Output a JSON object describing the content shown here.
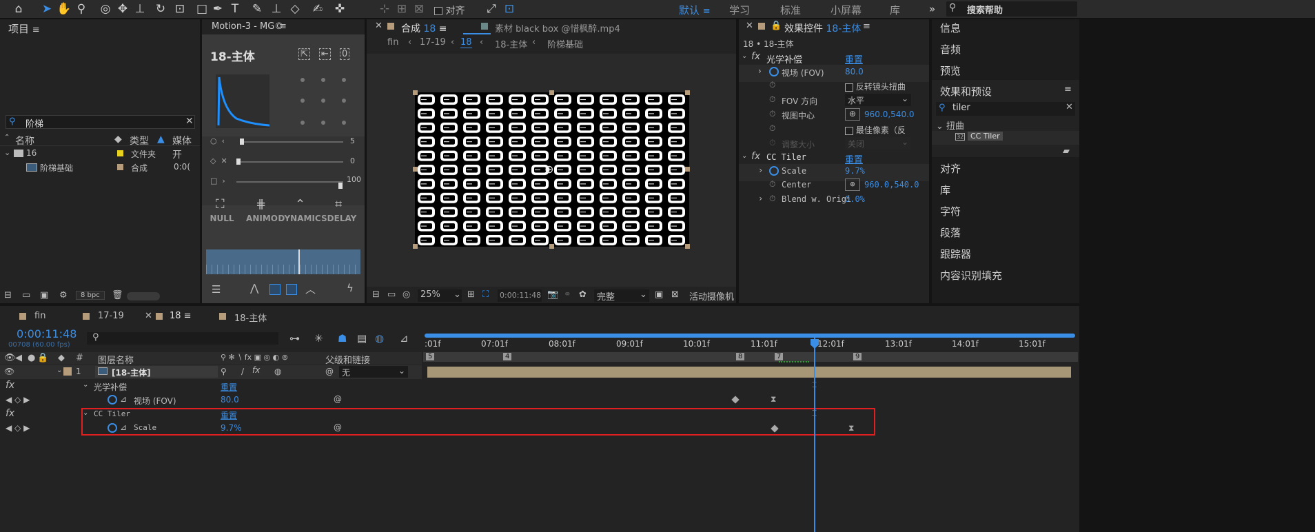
{
  "toolbar": {
    "snap_label": "对齐",
    "workspaces": [
      "默认",
      "学习",
      "标准",
      "小屏幕",
      "库"
    ],
    "more": "»",
    "search_help": "搜索帮助"
  },
  "project": {
    "title": "项目",
    "search_value": "阶梯",
    "columns": {
      "name": "名称",
      "type": "类型",
      "media": "媒体开"
    },
    "items": [
      {
        "name": "16",
        "type": "文件夹",
        "media": ""
      },
      {
        "name": "阶梯基础",
        "type": "合成",
        "media": "0:0("
      }
    ],
    "bpc": "8 bpc"
  },
  "motion": {
    "title": "Motion-3 - MG©",
    "comp": "18-主体",
    "sliders": [
      {
        "value": "5"
      },
      {
        "value": "0"
      },
      {
        "value": "100"
      }
    ],
    "buttons": [
      "NULL",
      "ANIMO",
      "DYNAMICS",
      "DELAY"
    ]
  },
  "comp_viewer": {
    "tab_label": "合成",
    "tab_number": "18",
    "footage_tab": "素材 black box @惜枫醉.mp4",
    "breadcrumbs": [
      "fin",
      "17-19",
      "18",
      "18-主体",
      "阶梯基础"
    ],
    "zoom": "25%",
    "timecode": "0:00:11:48",
    "quality": "完整",
    "camera": "活动摄像机"
  },
  "effects_controls": {
    "title": "效果控件",
    "layer": "18-主体",
    "path": "18 • 18-主体",
    "optics": {
      "name": "光学补偿",
      "reset": "重置",
      "fov_label": "视场 (FOV)",
      "fov_value": "80.0",
      "reverse": "反转镜头扭曲",
      "fov_dir_label": "FOV 方向",
      "fov_dir_value": "水平",
      "view_center_label": "视图中心",
      "view_center_value": "960.0,540.0",
      "best_pixels": "最佳像素（反",
      "resize_label": "调整大小",
      "resize_value": "关闭"
    },
    "tiler": {
      "name": "CC Tiler",
      "reset": "重置",
      "scale_label": "Scale",
      "scale_value": "9.7%",
      "center_label": "Center",
      "center_value": "960.0,540.0",
      "blend_label": "Blend w. Origi",
      "blend_value": "0.0%"
    }
  },
  "right_panels": {
    "items_top": [
      "信息",
      "音频",
      "预览"
    ],
    "effects_presets": "效果和预设",
    "search_value": "tiler",
    "category": "扭曲",
    "effect": "CC Tiler",
    "items_bottom": [
      "对齐",
      "库",
      "字符",
      "段落",
      "跟踪器",
      "内容识别填充"
    ]
  },
  "timeline": {
    "tabs": [
      "fin",
      "17-19",
      "18",
      "18-主体"
    ],
    "timecode": "0:00:11:48",
    "frames": "00708 (60.00 fps)",
    "ruler": [
      ":01f",
      "07:01f",
      "08:01f",
      "09:01f",
      "10:01f",
      "11:01f",
      "12:01f",
      "13:01f",
      "14:01f",
      "15:01f"
    ],
    "markers": [
      "5",
      "4",
      "8",
      "7",
      "9"
    ],
    "col_layer_name": "图层名称",
    "col_parent": "父级和链接",
    "layer_num": "1",
    "layer_name": "[18-主体]",
    "parent_value": "无",
    "fx_rows": [
      {
        "name": "光学补偿",
        "reset": "重置",
        "prop": "视场 (FOV)",
        "value": "80.0"
      },
      {
        "name": "CC Tiler",
        "reset": "重置",
        "prop": "Scale",
        "value": "9.7%"
      }
    ]
  },
  "colors": {
    "accent": "#3a8ee6",
    "highlight": "#e02020",
    "layer_bar": "#a89776"
  }
}
